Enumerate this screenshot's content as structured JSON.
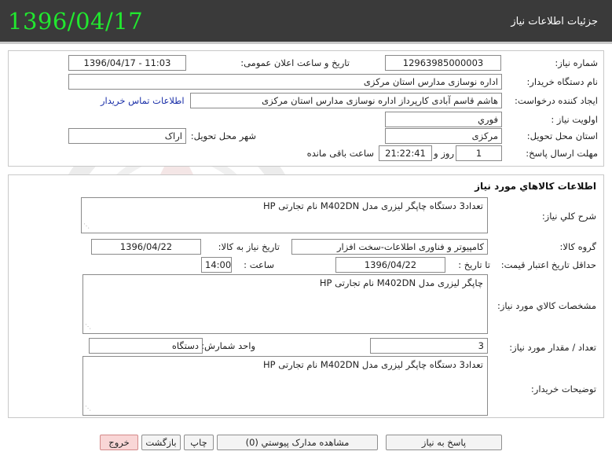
{
  "header": {
    "title": "جزئیات اطلاعات نیاز",
    "date": "1396/04/17"
  },
  "info": {
    "need_number_label": "شماره نیاز:",
    "need_number": "12963985000003",
    "announce_label": "تاریخ و ساعت اعلان عمومی:",
    "announce_value": "1396/04/17 - 11:03",
    "buyer_label": "نام دستگاه خریدار:",
    "buyer_value": "اداره نوسازی مدارس استان مرکزی",
    "creator_label": "ایجاد کننده درخواست:",
    "creator_value": "هاشم  قاسم آبادی کارپرداز اداره نوسازی مدارس استان مرکزی",
    "contact_link": "اطلاعات تماس خریدار",
    "priority_label": "اولویت نیاز :",
    "priority_value": "فوري",
    "province_label": "استان محل تحویل:",
    "province_value": "مرکزی",
    "city_label": "شهر محل تحویل:",
    "city_value": "اراک",
    "deadline_label": "مهلت ارسال پاسخ:",
    "deadline_days": "1",
    "days_word": "روز و",
    "deadline_time": "21:22:41",
    "remaining_word": "ساعت باقی مانده"
  },
  "goods": {
    "section_title": "اطلاعات کالاهاي مورد نیاز",
    "summary_label": "شرح کلي نیاز:",
    "summary_value": "تعداد3 دستگاه چاپگر لیزری مدل M402DN نام تجارتی HP",
    "group_label": "گروه کالا:",
    "group_value": "کامپیوتر و فناوری اطلاعات-سخت افزار",
    "need_date_label": "تاریخ نیاز به کالا:",
    "need_date_value": "1396/04/22",
    "min_validity_label": "حداقل تاریخ اعتبار قیمت:",
    "until_date_label": "تا تاریخ :",
    "until_date_value": "1396/04/22",
    "time_label": "ساعت :",
    "time_value": "14:00",
    "specs_label": "مشخصات کالاي مورد نیاز:",
    "specs_value": "چاپگر لیزری مدل M402DN نام تجارتی HP",
    "qty_label": "تعداد / مقدار مورد نیاز:",
    "qty_value": "3",
    "unit_label": "واحد شمارش:",
    "unit_value": "دستگاه",
    "buyer_notes_label": "توضیحات خریدار:",
    "buyer_notes_value": "تعداد3 دستگاه چاپگر لیزری مدل M402DN نام تجارتی HP"
  },
  "buttons": {
    "reply": "پاسخ به نیاز",
    "attachments": "مشاهده مدارک پیوستي (0)",
    "print": "چاپ",
    "back": "بازگشت",
    "exit": "خروج"
  },
  "colors": {
    "header_bg": "#3a3a3a",
    "header_date": "#21e82f",
    "link": "#1a2fa8",
    "exit_bg": "#f9d6d6"
  },
  "watermark": {
    "icon": "hazare-tender-logo-watermark"
  }
}
